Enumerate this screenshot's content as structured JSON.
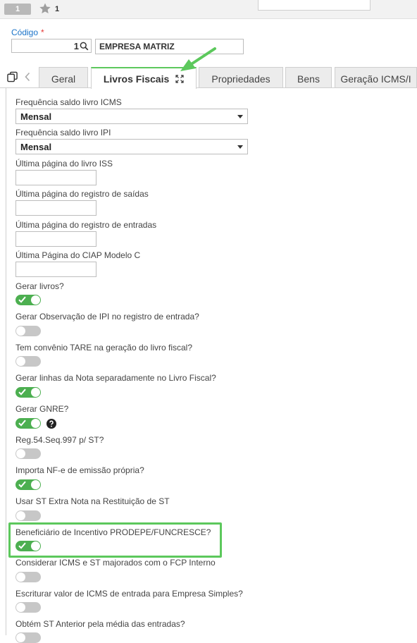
{
  "header": {
    "record_badge": "1",
    "record_number": "1"
  },
  "form": {
    "codigo_label": "Código",
    "required_mark": "*",
    "codigo_value": "1",
    "empresa_name": "EMPRESA MATRIZ"
  },
  "tabs": [
    {
      "label": "Geral"
    },
    {
      "label": "Livros Fiscais"
    },
    {
      "label": "Propriedades"
    },
    {
      "label": "Bens"
    },
    {
      "label": "Geração ICMS/I"
    }
  ],
  "fields": {
    "freq_icms": {
      "label": "Frequência saldo livro ICMS",
      "value": "Mensal"
    },
    "freq_ipi": {
      "label": "Frequência saldo livro IPI",
      "value": "Mensal"
    },
    "ult_pag_iss": {
      "label": "Última página do livro ISS",
      "value": ""
    },
    "ult_pag_saidas": {
      "label": "Última página do registro de saídas",
      "value": ""
    },
    "ult_pag_entradas": {
      "label": "Última página do registro de entradas",
      "value": ""
    },
    "ult_pag_ciap": {
      "label": "Última Página do CIAP Modelo C",
      "value": ""
    }
  },
  "toggles": [
    {
      "label": "Gerar livros?",
      "on": true
    },
    {
      "label": "Gerar Observação de IPI no registro de entrada?",
      "on": false
    },
    {
      "label": "Tem convênio TARE na geração do livro fiscal?",
      "on": false
    },
    {
      "label": "Gerar linhas da Nota separadamente no Livro Fiscal?",
      "on": true
    },
    {
      "label": "Gerar GNRE?",
      "on": true
    },
    {
      "label": "Reg.54.Seq.997 p/ ST?",
      "on": false
    },
    {
      "label": "Importa NF-e de emissão própria?",
      "on": true
    },
    {
      "label": "Usar ST Extra Nota na Restituição de ST",
      "on": false
    },
    {
      "label": "Beneficiário de Incentivo PRODEPE/FUNCRESCE?",
      "on": true
    },
    {
      "label": "Considerar ICMS e ST majorados com o FCP Interno",
      "on": false
    },
    {
      "label": "Escriturar valor de ICMS de entrada para Empresa Simples?",
      "on": false
    },
    {
      "label": "Obtém ST Anterior pela média das entradas?",
      "on": false
    }
  ],
  "colors": {
    "accent_green": "#5cc85c",
    "toggle_on": "#4caf50",
    "toggle_off": "#c7c7c7",
    "link_blue": "#1a73c8",
    "required_red": "#e53935"
  },
  "icons": [
    "star-icon",
    "search-icon",
    "copy-icon",
    "chevron-left-icon",
    "expand-icon",
    "help-icon",
    "check-icon",
    "arrow-annotation"
  ]
}
